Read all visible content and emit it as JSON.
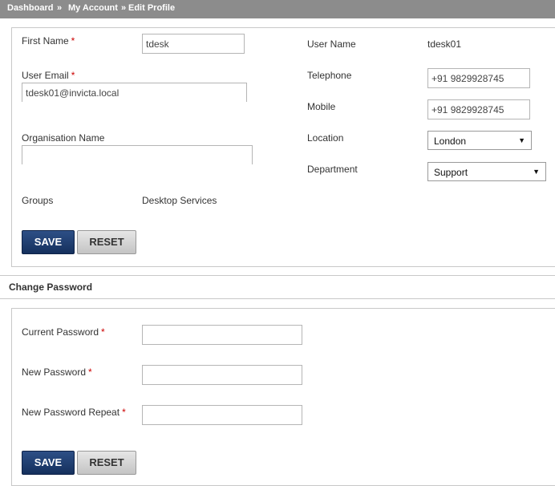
{
  "breadcrumb": {
    "items": [
      "Dashboard",
      "My Account",
      "Edit Profile"
    ],
    "separator": "»"
  },
  "profile": {
    "first_name": {
      "label": "First Name",
      "required": "*",
      "value": "tdesk"
    },
    "user_email": {
      "label": "User Email",
      "required": "*",
      "value": "tdesk01@invicta.local"
    },
    "organisation": {
      "label": "Organisation Name",
      "value": ""
    },
    "groups": {
      "label": "Groups",
      "value": "Desktop Services"
    },
    "user_name": {
      "label": "User Name",
      "value": "tdesk01"
    },
    "telephone": {
      "label": "Telephone",
      "value": "+91 9829928745"
    },
    "mobile": {
      "label": "Mobile",
      "value": "+91 9829928745"
    },
    "location": {
      "label": "Location",
      "value": "London"
    },
    "department": {
      "label": "Department",
      "value": "Support"
    },
    "save_label": "SAVE",
    "reset_label": "RESET"
  },
  "change_password": {
    "title": "Change Password",
    "current": {
      "label": "Current Password",
      "required": "*"
    },
    "new": {
      "label": "New Password",
      "required": "*"
    },
    "repeat": {
      "label": "New Password Repeat",
      "required": "*"
    },
    "save_label": "SAVE",
    "reset_label": "RESET"
  },
  "icons": {
    "dropdown": "▼"
  }
}
